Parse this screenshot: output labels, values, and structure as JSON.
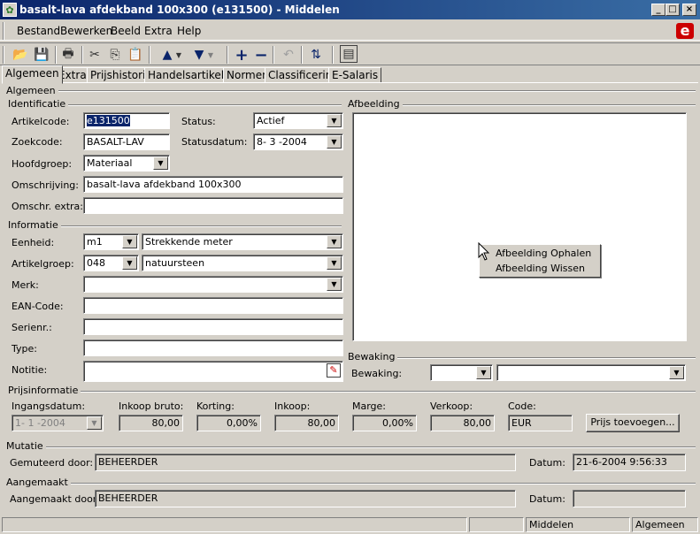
{
  "window": {
    "title": "basalt-lava afdekband 100x300 (e131500) - Middelen",
    "minimize": "_",
    "maximize": "□",
    "close": "×"
  },
  "menu": [
    "Bestand",
    "Bewerken",
    "Beeld",
    "Extra",
    "Help"
  ],
  "brand": {
    "logo": "e",
    "color": "#cc0000"
  },
  "tabs": [
    "Algemeen",
    "Extra",
    "Prijshistorie",
    "Handelsartikelen",
    "Normen",
    "Classificering",
    "E-Salaris"
  ],
  "section": "Algemeen",
  "identificatie": {
    "header": "Identificatie",
    "artikelcode_label": "Artikelcode:",
    "artikelcode": "e131500",
    "status_label": "Status:",
    "status": "Actief",
    "zoekcode_label": "Zoekcode:",
    "zoekcode": "BASALT-LAV",
    "statusdatum_label": "Statusdatum:",
    "statusdatum": "8- 3 -2004",
    "hoofdgroep_label": "Hoofdgroep:",
    "hoofdgroep": "Materiaal",
    "omschrijving_label": "Omschrijving:",
    "omschrijving": "basalt-lava afdekband 100x300",
    "omschr_extra_label": "Omschr. extra:",
    "omschr_extra": ""
  },
  "informatie": {
    "header": "Informatie",
    "eenheid_label": "Eenheid:",
    "eenheid_code": "m1",
    "eenheid_desc": "Strekkende meter",
    "artikelgroep_label": "Artikelgroep:",
    "artikelgroep_code": "048",
    "artikelgroep_desc": "natuursteen",
    "merk_label": "Merk:",
    "ean_label": "EAN-Code:",
    "serienr_label": "Serienr.:",
    "type_label": "Type:",
    "notitie_label": "Notitie:"
  },
  "afbeelding": {
    "header": "Afbeelding",
    "context_menu": [
      "Afbeelding Ophalen",
      "Afbeelding Wissen"
    ]
  },
  "bewaking": {
    "header": "Bewaking",
    "label": "Bewaking:"
  },
  "prijsinformatie": {
    "header": "Prijsinformatie",
    "ingangsdatum_label": "Ingangsdatum:",
    "ingangsdatum": "1- 1 -2004",
    "inkoop_bruto_label": "Inkoop bruto:",
    "inkoop_bruto": "80,00",
    "korting_label": "Korting:",
    "korting": "0,00%",
    "inkoop_label": "Inkoop:",
    "inkoop": "80,00",
    "marge_label": "Marge:",
    "marge": "0,00%",
    "verkoop_label": "Verkoop:",
    "verkoop": "80,00",
    "code_label": "Code:",
    "code": "EUR",
    "prijs_toevoegen": "Prijs toevoegen..."
  },
  "mutatie": {
    "header": "Mutatie",
    "gemuteerd_door_label": "Gemuteerd door:",
    "gemuteerd_door": "BEHEERDER",
    "datum_label": "Datum:",
    "datum": "21-6-2004 9:56:33"
  },
  "aangemaakt": {
    "header": "Aangemaakt",
    "aangemaakt_door_label": "Aangemaakt door:",
    "aangemaakt_door": "BEHEERDER",
    "datum_label": "Datum:",
    "datum": ""
  },
  "status": {
    "module": "Middelen",
    "tab": "Algemeen"
  }
}
